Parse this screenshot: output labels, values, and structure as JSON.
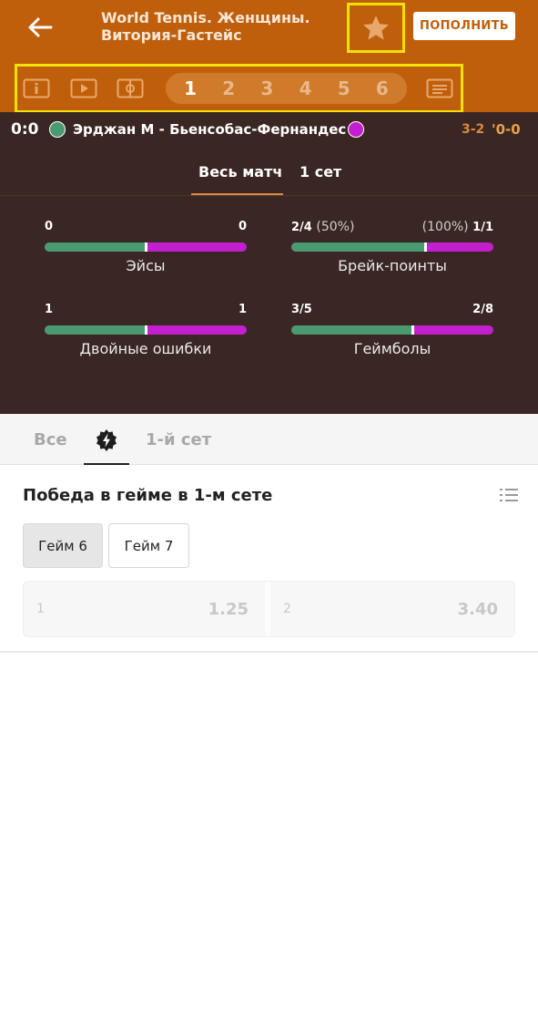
{
  "header": {
    "title_line1": "World Tennis. Женщины.",
    "title_line2": "Витория-Гастейс",
    "topup_label": "ПОПОЛНИТЬ",
    "back_icon": "arrow-left-icon",
    "favorite_icon": "star-icon"
  },
  "nav": {
    "icons": [
      "info-icon",
      "video-play-icon",
      "field-icon",
      "scoreboard-icon"
    ],
    "sets": [
      "1",
      "2",
      "3",
      "4",
      "5",
      "6"
    ],
    "active_set": "1"
  },
  "score": {
    "main": "0:0",
    "players": "Эрджан М - Бьенсобас-Фернандес О",
    "sets": "3-2",
    "game": "'0-0",
    "player1_color": "#4a9b71",
    "player2_color": "#c41fcf"
  },
  "period_tabs": {
    "full": "Весь матч",
    "set1": "1 сет"
  },
  "stats": {
    "aces": {
      "label": "Эйсы",
      "left": "0",
      "right": "0",
      "share": 0.5
    },
    "break_points": {
      "label": "Брейк-поинты",
      "left": "2/4",
      "left_pct": "(50%)",
      "right_pct": "(100%)",
      "right": "1/1",
      "share": 0.66
    },
    "double_faults": {
      "label": "Двойные ошибки",
      "left": "1",
      "right": "1",
      "share": 0.5
    },
    "game_points": {
      "label": "Геймболы",
      "left": "3/5",
      "right": "2/8",
      "share": 0.6
    }
  },
  "market_tabs": {
    "all": "Все",
    "live_icon": "lightning-badge-icon",
    "set1": "1-й сет"
  },
  "market": {
    "title": "Победа в гейме в 1-м сете",
    "list_icon": "list-icon",
    "games": [
      "Гейм 6",
      "Гейм 7"
    ],
    "outcomes": [
      {
        "name": "1",
        "odds": "1.25"
      },
      {
        "name": "2",
        "odds": "3.40"
      }
    ]
  }
}
